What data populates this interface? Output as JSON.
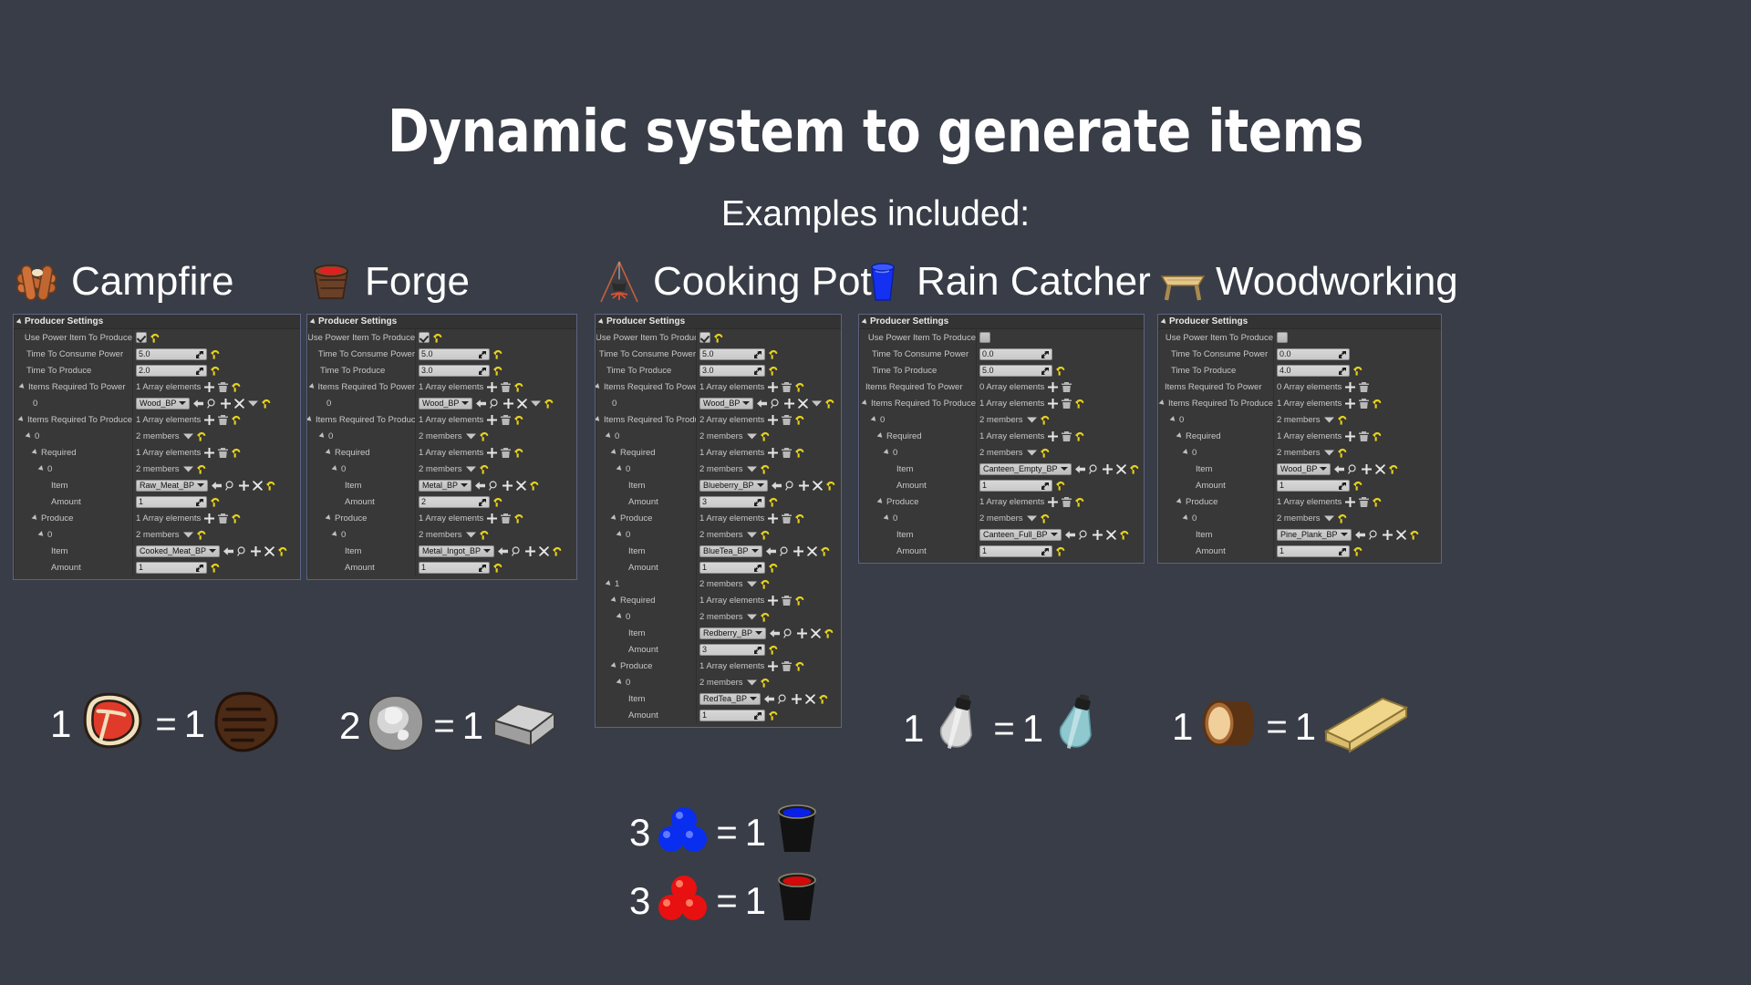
{
  "title": "Dynamic system to generate items",
  "subtitle": "Examples included:",
  "labels": {
    "panel_title": "Producer Settings",
    "use_power": "Use Power Item To Produce",
    "time_consume": "Time To Consume Power",
    "time_produce": "Time To Produce",
    "req_power": "Items Required To Power",
    "req_produce": "Items Required To Produce",
    "required": "Required",
    "produce": "Produce",
    "item": "Item",
    "amount": "Amount",
    "index0": "0",
    "index1": "1",
    "two_members": "2 members",
    "arr1": "1 Array elements",
    "arr2": "2 Array elements",
    "arr0": "0 Array elements"
  },
  "icons": {
    "expand": "triangle-expand-icon",
    "add": "plus-icon",
    "trash": "trash-icon",
    "reset": "reset-arrow-icon",
    "browse": "back-arrow-icon",
    "search": "magnifier-icon",
    "clear": "x-icon",
    "dropdown": "chevron-down-icon"
  },
  "colors": {
    "background": "#393d47",
    "panel_bg": "#383838",
    "panel_border": "#5b6484",
    "header_bg": "#333333",
    "text": "#c8c8c8",
    "reset_yellow": "#e8d21a",
    "title_white": "#ffffff"
  },
  "columns": [
    {
      "name": "Campfire",
      "icon": "campfire-logs-icon",
      "panel": {
        "use_power": true,
        "time_consume": "5.0",
        "time_produce": "2.0",
        "req_power_count": "1 Array elements",
        "req_power_item": "Wood_BP",
        "req_produce_count": "1 Array elements",
        "entries": [
          {
            "index": "0",
            "required_count": "1 Array elements",
            "required": [
              {
                "index": "0",
                "item": "Raw_Meat_BP",
                "amount": "1"
              }
            ],
            "produce_count": "1 Array elements",
            "produce": [
              {
                "index": "0",
                "item": "Cooked_Meat_BP",
                "amount": "1"
              }
            ]
          }
        ]
      },
      "equations": [
        {
          "in_count": "1",
          "in_icon": "raw-meat-icon",
          "eq": "=",
          "out_count": "1",
          "out_icon": "cooked-meat-icon"
        }
      ]
    },
    {
      "name": "Forge",
      "icon": "forge-bucket-icon",
      "panel": {
        "use_power": true,
        "time_consume": "5.0",
        "time_produce": "3.0",
        "req_power_count": "1 Array elements",
        "req_power_item": "Wood_BP",
        "req_produce_count": "1 Array elements",
        "entries": [
          {
            "index": "0",
            "required_count": "1 Array elements",
            "required": [
              {
                "index": "0",
                "item": "Metal_BP",
                "amount": "2"
              }
            ],
            "produce_count": "1 Array elements",
            "produce": [
              {
                "index": "0",
                "item": "Metal_Ingot_BP",
                "amount": "1"
              }
            ]
          }
        ]
      },
      "equations": [
        {
          "in_count": "2",
          "in_icon": "metal-ore-icon",
          "eq": "=",
          "out_count": "1",
          "out_icon": "metal-ingot-icon"
        }
      ]
    },
    {
      "name": "Cooking Pot",
      "icon": "cooking-pot-icon",
      "panel": {
        "use_power": true,
        "time_consume": "5.0",
        "time_produce": "3.0",
        "req_power_count": "1 Array elements",
        "req_power_item": "Wood_BP",
        "req_produce_count": "2 Array elements",
        "entries": [
          {
            "index": "0",
            "required_count": "1 Array elements",
            "required": [
              {
                "index": "0",
                "item": "Blueberry_BP",
                "amount": "3"
              }
            ],
            "produce_count": "1 Array elements",
            "produce": [
              {
                "index": "0",
                "item": "BlueTea_BP",
                "amount": "1"
              }
            ]
          },
          {
            "index": "1",
            "required_count": "1 Array elements",
            "required": [
              {
                "index": "0",
                "item": "Redberry_BP",
                "amount": "3"
              }
            ],
            "produce_count": "1 Array elements",
            "produce": [
              {
                "index": "0",
                "item": "RedTea_BP",
                "amount": "1"
              }
            ]
          }
        ]
      },
      "equations": [
        {
          "in_count": "3",
          "in_icon": "blueberry-icon",
          "eq": "=",
          "out_count": "1",
          "out_icon": "blue-tea-cup-icon"
        },
        {
          "in_count": "3",
          "in_icon": "redberry-icon",
          "eq": "=",
          "out_count": "1",
          "out_icon": "red-tea-cup-icon"
        }
      ]
    },
    {
      "name": "Rain Catcher",
      "icon": "rain-catcher-cup-icon",
      "panel": {
        "use_power": false,
        "time_consume": "0.0",
        "time_produce": "5.0",
        "req_power_count": "0 Array elements",
        "req_power_item": null,
        "req_produce_count": "1 Array elements",
        "entries": [
          {
            "index": "0",
            "required_count": "1 Array elements",
            "required": [
              {
                "index": "0",
                "item": "Canteen_Empty_BP",
                "amount": "1"
              }
            ],
            "produce_count": "1 Array elements",
            "produce": [
              {
                "index": "0",
                "item": "Canteen_Full_BP",
                "amount": "1"
              }
            ]
          }
        ]
      },
      "equations": [
        {
          "in_count": "1",
          "in_icon": "empty-canteen-icon",
          "eq": "=",
          "out_count": "1",
          "out_icon": "full-canteen-icon"
        }
      ]
    },
    {
      "name": "Woodworking",
      "icon": "woodworking-bench-icon",
      "panel": {
        "use_power": false,
        "time_consume": "0.0",
        "time_produce": "4.0",
        "req_power_count": "0 Array elements",
        "req_power_item": null,
        "req_produce_count": "1 Array elements",
        "entries": [
          {
            "index": "0",
            "required_count": "1 Array elements",
            "required": [
              {
                "index": "0",
                "item": "Wood_BP",
                "amount": "1"
              }
            ],
            "produce_count": "1 Array elements",
            "produce": [
              {
                "index": "0",
                "item": "Pine_Plank_BP",
                "amount": "1"
              }
            ]
          }
        ]
      },
      "equations": [
        {
          "in_count": "1",
          "in_icon": "wood-log-icon",
          "eq": "=",
          "out_count": "1",
          "out_icon": "pine-plank-icon"
        }
      ]
    }
  ]
}
